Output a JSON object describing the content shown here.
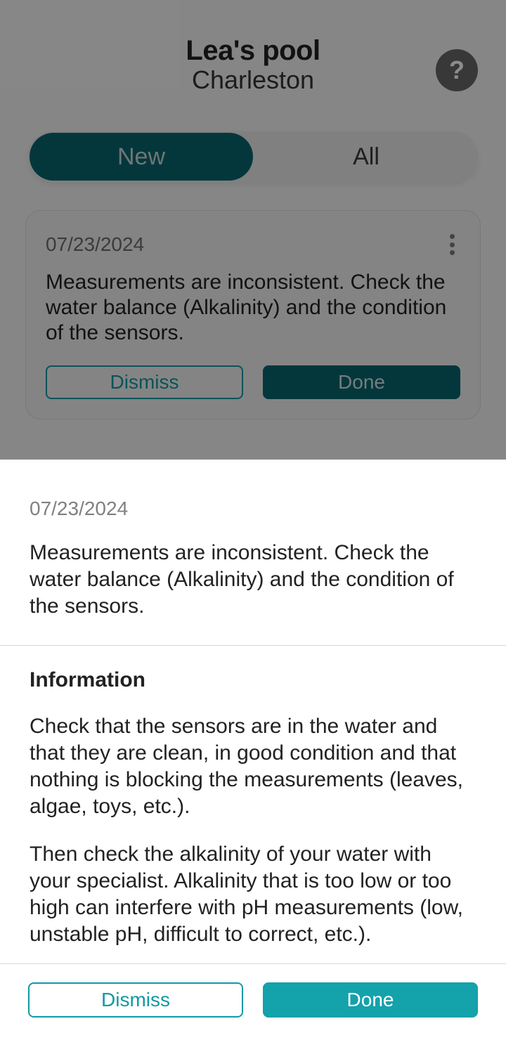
{
  "header": {
    "pool_name": "Lea's pool",
    "location": "Charleston",
    "help_glyph": "?"
  },
  "segmented": {
    "new": "New",
    "all": "All"
  },
  "card": {
    "date": "07/23/2024",
    "message": "Measurements are inconsistent. Check the water balance (Alkalinity) and the condition of the sensors.",
    "dismiss": "Dismiss",
    "done": "Done"
  },
  "sheet": {
    "date": "07/23/2024",
    "message": "Measurements are inconsistent. Check the water balance (Alkalinity) and the condition of the sensors.",
    "info_title": "Information",
    "info_p1": "Check that the sensors are in the water and that they are clean, in good condition and that nothing is blocking the measurements (leaves, algae,  toys, etc.).",
    "info_p2": "Then check the alkalinity of your water with your specialist. Alkalinity that is too low or too high can interfere with pH measurements (low, unstable pH, difficult to correct, etc.).",
    "dismiss": "Dismiss",
    "done": "Done"
  }
}
